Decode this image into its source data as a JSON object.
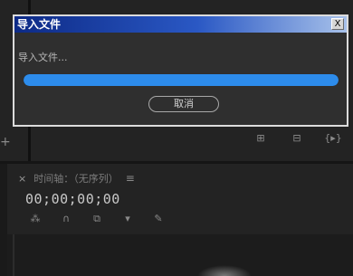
{
  "dialog": {
    "title": "导入文件",
    "close_label": "X",
    "message": "导入文件...",
    "progress": 1.0,
    "cancel_label": "取消",
    "accent_color": "#2d8ceb"
  },
  "source_panel": {
    "left_plus": "+",
    "icons": [
      "insert-icon",
      "overwrite-icon",
      "export-frame-icon"
    ]
  },
  "timeline": {
    "close": "×",
    "title": "时间轴：（无序列）",
    "menu": "≡",
    "timecode": "00;00;00;00",
    "tools": [
      "snap-icon",
      "magnet-icon",
      "linked-selection-icon",
      "marker-icon",
      "wrench-icon"
    ]
  }
}
